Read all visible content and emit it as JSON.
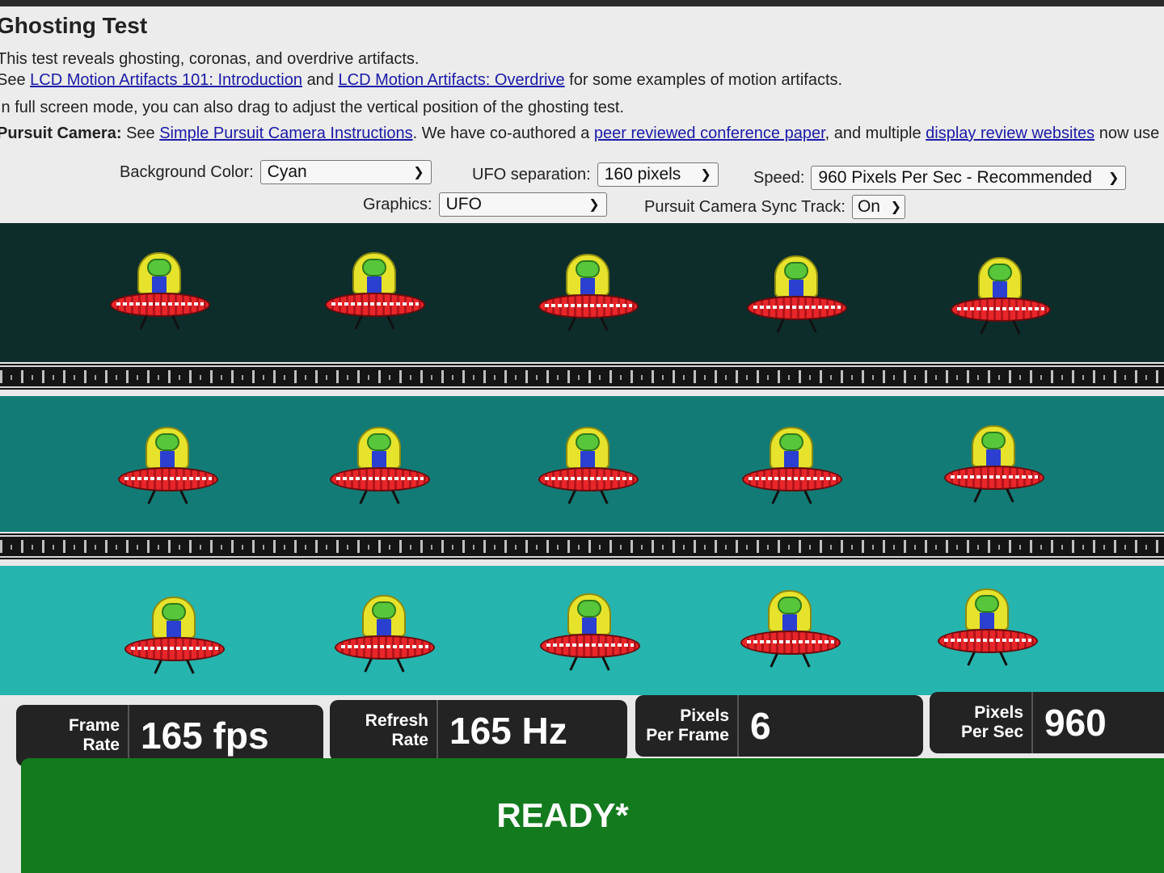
{
  "page": {
    "title": "Ghosting Test",
    "intro": "This test reveals ghosting, coronas, and overdrive artifacts.",
    "see_prefix": "See",
    "link1": "LCD Motion Artifacts 101: Introduction",
    "and_word": "and",
    "link2": "LCD Motion Artifacts: Overdrive",
    "see_suffix": "for some examples of motion artifacts.",
    "fullscreen_note": "In full screen mode, you can also drag to adjust the vertical position of the ghosting test.",
    "pursuit_label": "Pursuit Camera:",
    "pursuit_see": "See",
    "pursuit_link": "Simple Pursuit Camera Instructions",
    "pursuit_mid": ". We have co-authored a",
    "paper_link": "peer reviewed conference paper",
    "pursuit_mid2": ", and multiple",
    "review_link": "display review websites",
    "pursuit_tail": "now use t"
  },
  "controls": {
    "background_label": "Background Color:",
    "background_value": "Cyan",
    "separation_label": "UFO separation:",
    "separation_value": "160 pixels",
    "speed_label": "Speed:",
    "speed_value": "960 Pixels Per Sec - Recommended",
    "graphics_label": "Graphics:",
    "graphics_value": "UFO",
    "sync_label": "Pursuit Camera Sync Track:",
    "sync_value": "On"
  },
  "stats": {
    "frame_rate_label_1": "Frame",
    "frame_rate_label_2": "Rate",
    "frame_rate_value": "165 fps",
    "refresh_label_1": "Refresh",
    "refresh_label_2": "Rate",
    "refresh_value": "165 Hz",
    "ppf_label_1": "Pixels",
    "ppf_label_2": "Per Frame",
    "ppf_value": "6",
    "pps_label_1": "Pixels",
    "pps_label_2": "Per Sec",
    "pps_value": "960"
  },
  "status": {
    "ready": "READY*"
  },
  "colors": {
    "band_dark": "#0d2d2b",
    "band_mid": "#137b76",
    "band_light": "#26b4ae",
    "ready_green": "#137a1e",
    "link_blue": "#1a1aa8"
  },
  "icons": [
    "ufo-icon",
    "chevron-down-icon"
  ]
}
